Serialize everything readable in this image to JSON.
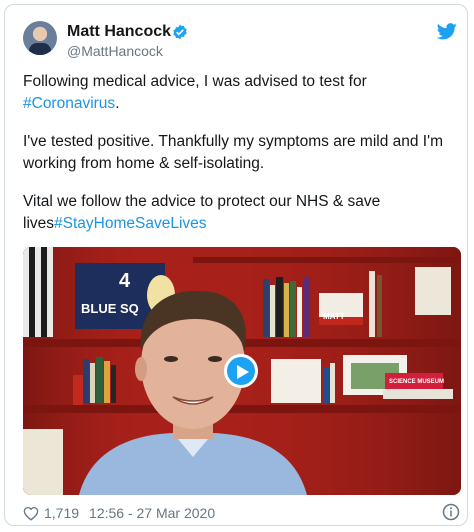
{
  "author": {
    "name": "Matt Hancock",
    "handle": "@MattHancock"
  },
  "tweet": {
    "p1_text": "Following medical advice, I was advised to test for ",
    "p1_hashtag": "#Coronavirus",
    "p1_end": ".",
    "p2_text": "I've tested positive. Thankfully my symptoms are mild and I'm working from home & self-isolating.",
    "p3_text": "Vital we follow the advice to protect our NHS & save lives",
    "p3_hashtag": "#StayHomeSaveLives"
  },
  "media": {
    "jersey_text": "BLUE SQ",
    "jersey_number": "4",
    "sign_text": "MATT",
    "box_text": "SCIENCE MUSEUM"
  },
  "footer": {
    "likes": "1,719",
    "timestamp": "12:56 - 27 Mar 2020"
  },
  "colors": {
    "accent": "#1da1f2",
    "hashtag": "#1b95e0",
    "wall": "#b3241c"
  }
}
